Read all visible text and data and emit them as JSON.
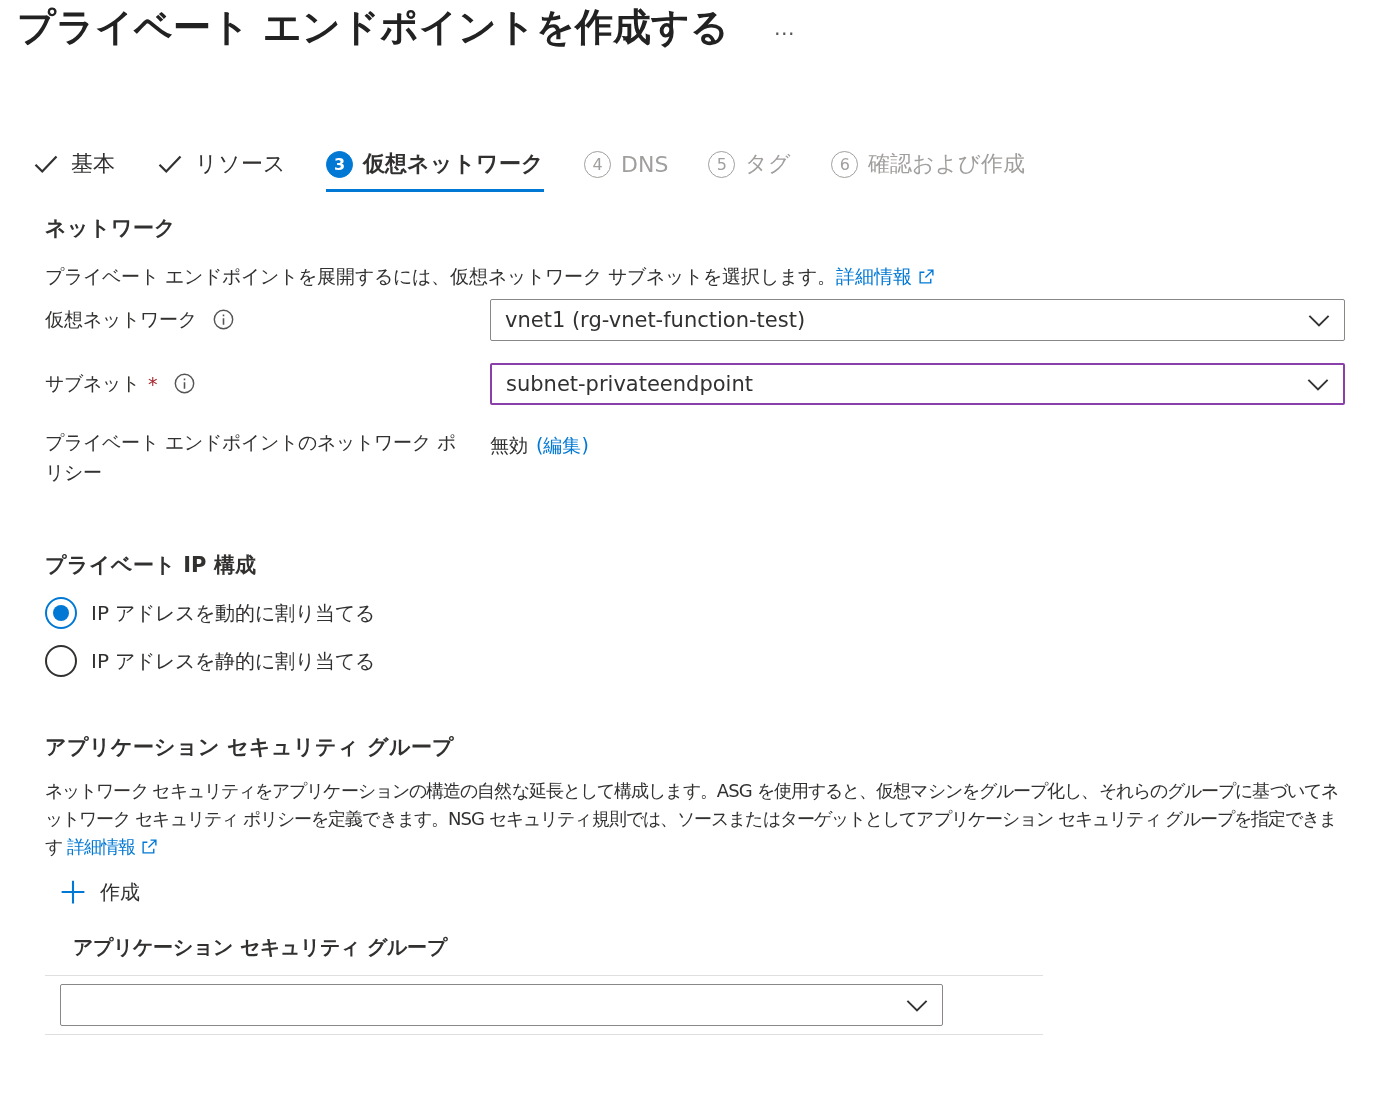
{
  "page": {
    "title": "プライベート エンドポイントを作成する",
    "more": "…"
  },
  "tabs": [
    {
      "kind": "done",
      "label": "基本",
      "selected": false
    },
    {
      "kind": "done",
      "label": "リソース",
      "selected": false
    },
    {
      "kind": "step",
      "number": "3",
      "label": "仮想ネットワーク",
      "selected": true
    },
    {
      "kind": "step",
      "number": "4",
      "label": "DNS",
      "selected": false
    },
    {
      "kind": "step",
      "number": "5",
      "label": "タグ",
      "selected": false
    },
    {
      "kind": "step",
      "number": "6",
      "label": "確認および作成",
      "selected": false
    }
  ],
  "network": {
    "heading": "ネットワーク",
    "description": "プライベート エンドポイントを展開するには、仮想ネットワーク サブネットを選択します。",
    "link": "詳細情報",
    "fields": [
      {
        "kind": "dropdown",
        "label": "仮想ネットワーク",
        "info": true,
        "value": "vnet1 (rg-vnet-function-test)",
        "focused": false
      },
      {
        "kind": "dropdown",
        "label": "サブネット",
        "required_mark": "*",
        "info": true,
        "value": "subnet-privateendpoint",
        "focused": true
      },
      {
        "kind": "text",
        "label": "プライベート エンドポイントのネットワーク ポリシー",
        "info": false,
        "value": "無効",
        "link": "(編集)"
      }
    ]
  },
  "ip_config": {
    "heading": "プライベート IP 構成",
    "options": [
      {
        "label": "IP アドレスを動的に割り当てる",
        "selected": true
      },
      {
        "label": "IP アドレスを静的に割り当てる",
        "selected": false
      }
    ]
  },
  "asg": {
    "heading": "アプリケーション セキュリティ グループ",
    "description": "ネットワーク セキュリティをアプリケーションの構造の自然な延長として構成します。ASG を使用すると、仮想マシンをグループ化し、それらのグループに基づいてネットワーク セキュリティ ポリシーを定義できます。NSG セキュリティ規則では、ソースまたはターゲットとしてアプリケーション セキュリティ グループを指定できます",
    "link": "詳細情報",
    "create": "作成",
    "table": {
      "column": "アプリケーション セキュリティ グループ"
    }
  }
}
